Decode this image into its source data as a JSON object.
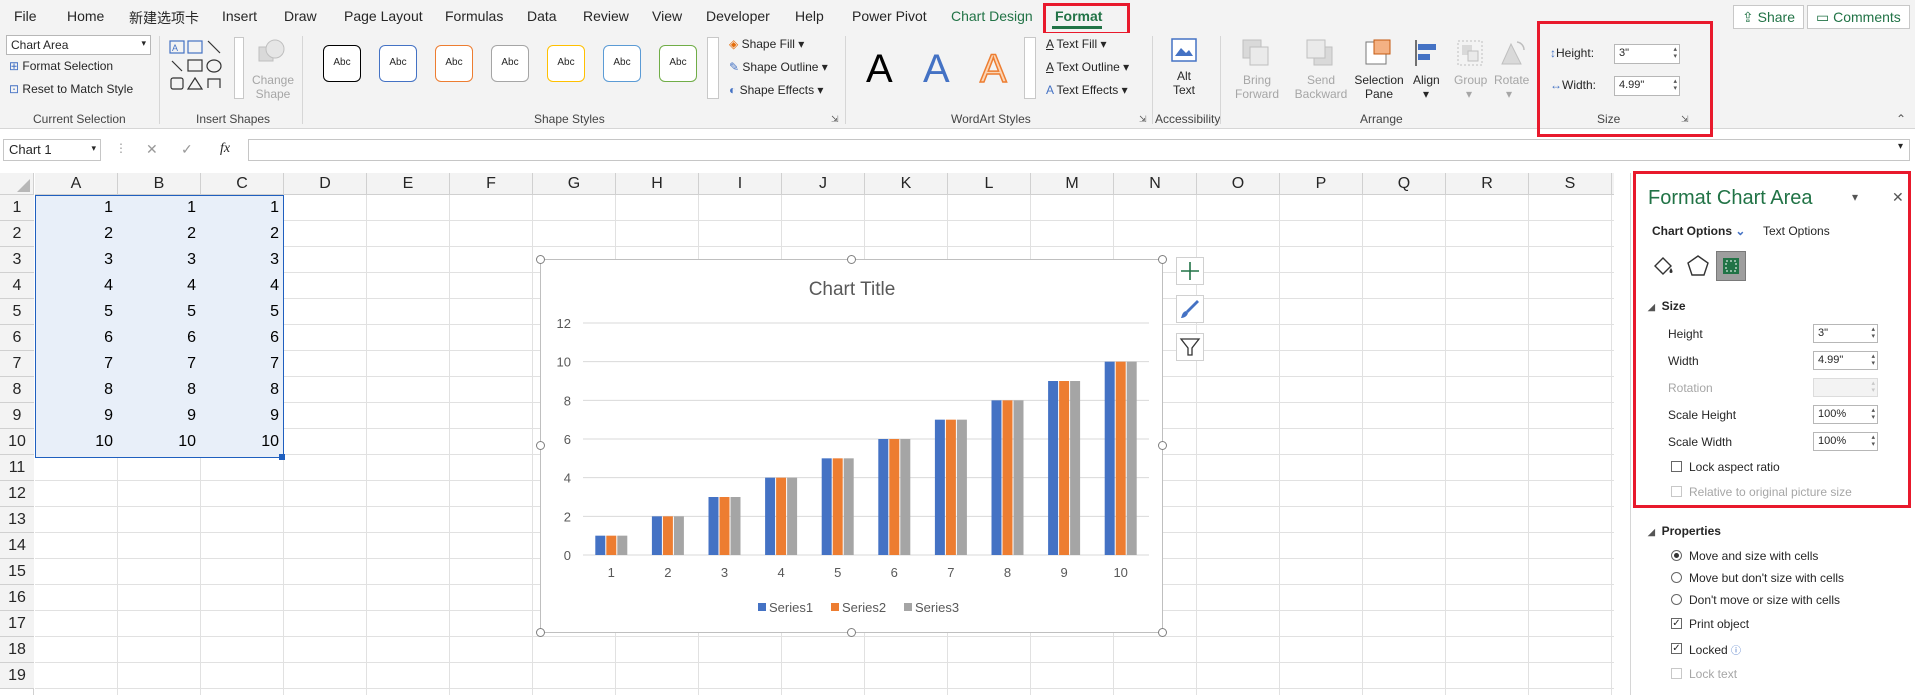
{
  "menu": {
    "tabs": [
      "File",
      "Home",
      "新建选项卡",
      "Insert",
      "Draw",
      "Page Layout",
      "Formulas",
      "Data",
      "Review",
      "View",
      "Developer",
      "Help",
      "Power Pivot",
      "Chart Design",
      "Format"
    ],
    "share": "Share",
    "comments": "Comments"
  },
  "ribbon": {
    "current_selection": {
      "dropdown_value": "Chart Area",
      "format_selection": "Format Selection",
      "reset_to_match_style": "Reset to Match Style",
      "group_label": "Current Selection"
    },
    "insert_shapes": {
      "change_shape": "Change Shape",
      "group_label": "Insert Shapes"
    },
    "shape_styles": {
      "swatch_text": "Abc",
      "swatch_colors": [
        "#000000",
        "#4472c4",
        "#ed7d31",
        "#a5a5a5",
        "#ffc000",
        "#5b9bd5",
        "#70ad47"
      ],
      "shape_fill": "Shape Fill",
      "shape_outline": "Shape Outline",
      "shape_effects": "Shape Effects",
      "group_label": "Shape Styles"
    },
    "wordart": {
      "letter": "A",
      "text_fill": "Text Fill",
      "text_outline": "Text Outline",
      "text_effects": "Text Effects",
      "group_label": "WordArt Styles"
    },
    "accessibility": {
      "alt_text_line1": "Alt",
      "alt_text_line2": "Text",
      "group_label": "Accessibility"
    },
    "arrange": {
      "bring_forward": "Bring Forward",
      "send_backward": "Send Backward",
      "selection_pane": "Selection Pane",
      "align": "Align",
      "group": "Group",
      "rotate": "Rotate",
      "group_label": "Arrange"
    },
    "size": {
      "height_label": "Height:",
      "height_value": "3\"",
      "width_label": "Width:",
      "width_value": "4.99\"",
      "group_label": "Size"
    }
  },
  "formula_bar": {
    "name_box": "Chart 1",
    "fx": "fx",
    "formula": ""
  },
  "grid": {
    "columns": [
      "A",
      "B",
      "C",
      "D",
      "E",
      "F",
      "G",
      "H",
      "I",
      "J",
      "K",
      "L",
      "M",
      "N",
      "O",
      "P",
      "Q",
      "R",
      "S"
    ],
    "rows": [
      "1",
      "2",
      "3",
      "4",
      "5",
      "6",
      "7",
      "8",
      "9",
      "10",
      "11",
      "12",
      "13",
      "14",
      "15",
      "16",
      "17",
      "18",
      "19"
    ],
    "data": [
      [
        1,
        1,
        1
      ],
      [
        2,
        2,
        2
      ],
      [
        3,
        3,
        3
      ],
      [
        4,
        4,
        4
      ],
      [
        5,
        5,
        5
      ],
      [
        6,
        6,
        6
      ],
      [
        7,
        7,
        7
      ],
      [
        8,
        8,
        8
      ],
      [
        9,
        9,
        9
      ],
      [
        10,
        10,
        10
      ]
    ]
  },
  "chart_data": {
    "type": "bar",
    "title": "Chart Title",
    "categories": [
      "1",
      "2",
      "3",
      "4",
      "5",
      "6",
      "7",
      "8",
      "9",
      "10"
    ],
    "series": [
      {
        "name": "Series1",
        "color": "#4472c4",
        "values": [
          1,
          2,
          3,
          4,
          5,
          6,
          7,
          8,
          9,
          10
        ]
      },
      {
        "name": "Series2",
        "color": "#ed7d31",
        "values": [
          1,
          2,
          3,
          4,
          5,
          6,
          7,
          8,
          9,
          10
        ]
      },
      {
        "name": "Series3",
        "color": "#a5a5a5",
        "values": [
          1,
          2,
          3,
          4,
          5,
          6,
          7,
          8,
          9,
          10
        ]
      }
    ],
    "ylim": [
      0,
      12
    ],
    "yticks": [
      "0",
      "2",
      "4",
      "6",
      "8",
      "10",
      "12"
    ],
    "grid": true,
    "legend": "bottom"
  },
  "pane": {
    "title": "Format Chart Area",
    "chart_options": "Chart Options",
    "text_options": "Text Options",
    "size_section": "Size",
    "height_label": "Height",
    "height_value": "3\"",
    "width_label": "Width",
    "width_value": "4.99\"",
    "rotation_label": "Rotation",
    "scale_height_label": "Scale Height",
    "scale_height_value": "100%",
    "scale_width_label": "Scale Width",
    "scale_width_value": "100%",
    "lock_aspect": "Lock aspect ratio",
    "relative_original": "Relative to original picture size",
    "properties_section": "Properties",
    "move_size": "Move and size with cells",
    "move_no_size": "Move but don't size with cells",
    "dont_move": "Don't move or size with cells",
    "print_object": "Print object",
    "locked": "Locked",
    "lock_text": "Lock text"
  },
  "colors": {
    "accent": "#217346",
    "highlight": "#e8192c",
    "selection_fill": "#e8eff9",
    "selection_border": "#1f5fbf"
  }
}
